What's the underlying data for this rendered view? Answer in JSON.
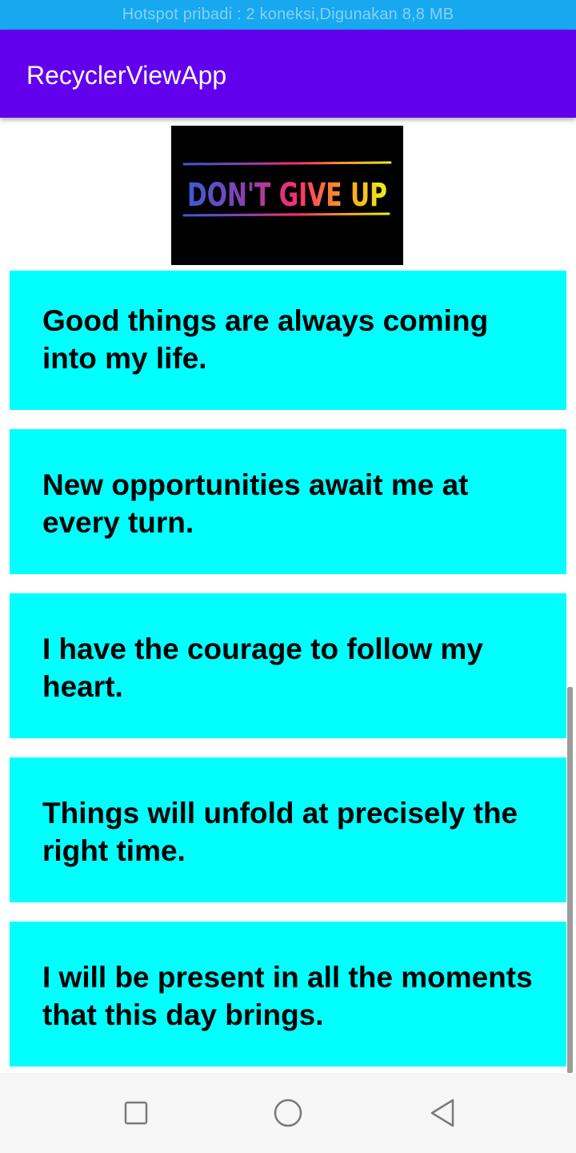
{
  "status_bar": {
    "text": "Hotspot pribadi : 2 koneksi,Digunakan 8,8 MB"
  },
  "app_bar": {
    "title": "RecyclerViewApp"
  },
  "banner": {
    "text": "DON'T GIVE UP"
  },
  "items": [
    {
      "text": "Good things are always coming into my life."
    },
    {
      "text": "New opportunities await me at every turn."
    },
    {
      "text": "I have the courage to follow my heart."
    },
    {
      "text": "Things will unfold at precisely the right time."
    },
    {
      "text": "I will be present in all the moments that this day brings."
    }
  ],
  "nav_bar": {
    "buttons": [
      "recents-icon",
      "home-icon",
      "back-icon"
    ]
  },
  "colors": {
    "status_bar": "#17A8F0",
    "app_bar": "#6200EE",
    "card": "#00FFFF"
  }
}
